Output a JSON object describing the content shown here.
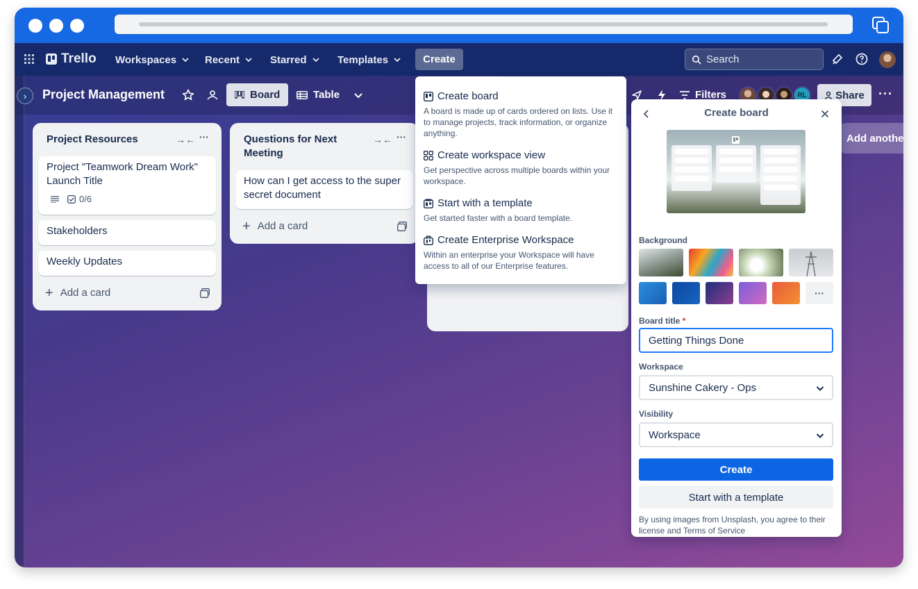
{
  "nav": {
    "brand": "Trello",
    "items": [
      "Workspaces",
      "Recent",
      "Starred",
      "Templates"
    ],
    "create_label": "Create",
    "search_label": "Search"
  },
  "board": {
    "title": "Project Management",
    "views": [
      "Board",
      "Table"
    ],
    "filters_label": "Filters",
    "share_label": "Share",
    "member_initials": "RL",
    "add_another_list": "Add another list"
  },
  "lists": [
    {
      "title": "Project Resources",
      "cards": [
        {
          "title": "Project \"Teamwork Dream Work\" Launch Title",
          "checklist": "0/6"
        },
        {
          "title": "Stakeholders"
        },
        {
          "title": "Weekly Updates"
        }
      ],
      "add_card": "Add a card"
    },
    {
      "title": "Questions for Next Meeting",
      "cards": [
        {
          "title": "How can I get access to the super secret document"
        }
      ],
      "add_card": "Add a card"
    }
  ],
  "create_menu": [
    {
      "title": "Create board",
      "desc": "A board is made up of cards ordered on lists. Use it to manage projects, track information, or organize anything."
    },
    {
      "title": "Create workspace view",
      "desc": "Get perspective across multiple boards within your workspace."
    },
    {
      "title": "Start with a template",
      "desc": "Get started faster with a board template."
    },
    {
      "title": "Create Enterprise Workspace",
      "desc": "Within an enterprise your Workspace will have access to all of our Enterprise features."
    }
  ],
  "create_board": {
    "title": "Create board",
    "background_label": "Background",
    "board_title_label": "Board title",
    "required_mark": "*",
    "board_title_value": "Getting Things Done",
    "workspace_label": "Workspace",
    "workspace_value": "Sunshine Cakery - Ops",
    "visibility_label": "Visibility",
    "visibility_value": "Workspace",
    "create_button": "Create",
    "template_button": "Start with a template",
    "legal_text": "By using images from Unsplash, you agree to their license and Terms of Service",
    "more_label": "···"
  },
  "colors": {
    "chrome": "#1768e3",
    "topnav": "#16296a",
    "primary": "#0c66e4",
    "required": "#c9372c"
  }
}
